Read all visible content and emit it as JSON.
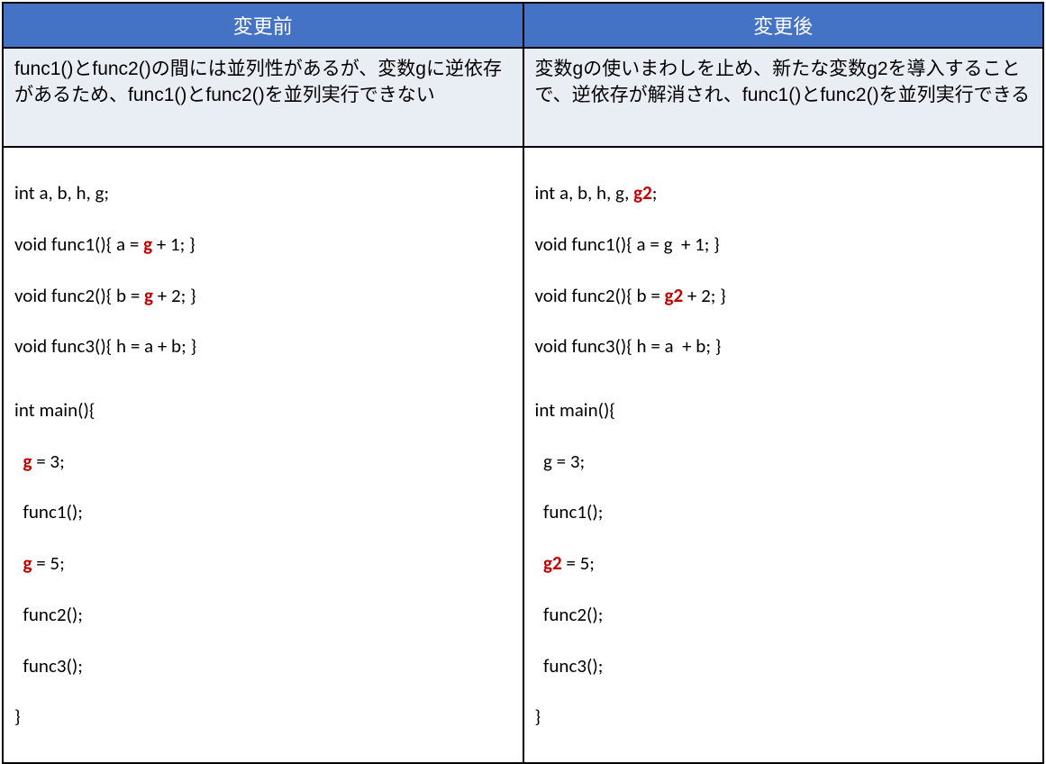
{
  "table": {
    "left": {
      "header": "変更前",
      "description": "func1()とfunc2()の間には並列性があるが、変数gに逆依存があるため、func1()とfunc2()を並列実行できない",
      "code": {
        "decl_pre": "int a, b, h, g;",
        "f1_pre": "void func1(){ a = ",
        "f1_hl": "g",
        "f1_post": " + 1; }",
        "f2_pre": "void func2(){ b = ",
        "f2_hl": "g",
        "f2_post": " + 2; }",
        "f3": "void func3(){ h = a + b; }",
        "main_open": "int main(){",
        "m1_pre": "  ",
        "m1_hl": "g",
        "m1_post": " = 3;",
        "m2": "  func1();",
        "m3_pre": "  ",
        "m3_hl": "g",
        "m3_post": " = 5;",
        "m4": "  func2();",
        "m5": "  func3();",
        "main_close": "}"
      }
    },
    "right": {
      "header": "変更後",
      "description": "変数gの使いまわしを止め、新たな変数g2を導入することで、逆依存が解消され、func1()とfunc2()を並列実行できる",
      "code": {
        "decl_pre": "int a, b, h, g, ",
        "decl_hl": "g2",
        "decl_post": ";",
        "f1": "void func1(){ a = g  + 1; }",
        "f2_pre": "void func2(){ b = ",
        "f2_hl": "g2",
        "f2_post": " + 2; }",
        "f3": "void func3(){ h = a  + b; }",
        "main_open": "int main(){",
        "m1": "  g = 3;",
        "m2": "  func1();",
        "m3_pre": "  ",
        "m3_hl": "g2",
        "m3_post": " = 5;",
        "m4": "  func2();",
        "m5": "  func3();",
        "main_close": "}"
      }
    }
  }
}
